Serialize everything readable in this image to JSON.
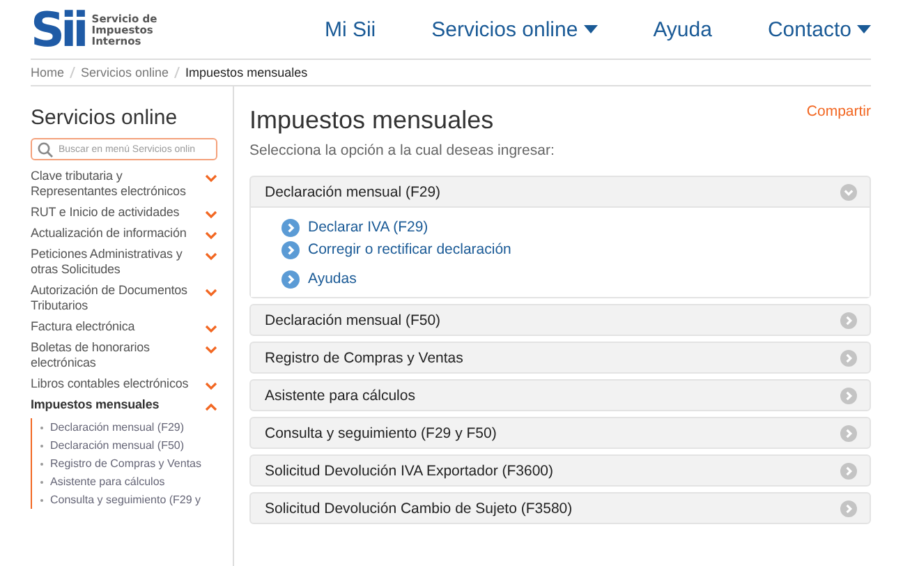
{
  "logo": {
    "mark": "Sii",
    "lines": [
      "Servicio de",
      "Impuestos",
      "Internos"
    ]
  },
  "nav": [
    {
      "label": "Mi Sii",
      "dropdown": false
    },
    {
      "label": "Servicios online",
      "dropdown": true
    },
    {
      "label": "Ayuda",
      "dropdown": false
    },
    {
      "label": "Contacto",
      "dropdown": true
    }
  ],
  "breadcrumb": [
    {
      "label": "Home",
      "current": false
    },
    {
      "label": "Servicios online",
      "current": false
    },
    {
      "label": "Impuestos mensuales",
      "current": true
    }
  ],
  "sidebar": {
    "title": "Servicios online",
    "search": {
      "placeholder": "Buscar en menú Servicios onlin"
    },
    "items": [
      {
        "label": "Clave tributaria y Representantes electrónicos",
        "expanded": false
      },
      {
        "label": "RUT e Inicio de actividades",
        "expanded": false
      },
      {
        "label": "Actualización de información",
        "expanded": false
      },
      {
        "label": "Peticiones Administrativas y otras Solicitudes",
        "expanded": false
      },
      {
        "label": "Autorización de Documentos Tributarios",
        "expanded": false
      },
      {
        "label": "Factura electrónica",
        "expanded": false
      },
      {
        "label": "Boletas de honorarios electrónicas",
        "expanded": false
      },
      {
        "label": "Libros contables electrónicos",
        "expanded": false
      },
      {
        "label": "Impuestos mensuales",
        "expanded": true,
        "children": [
          {
            "label": "Declaración mensual (F29)"
          },
          {
            "label": "Declaración mensual (F50)"
          },
          {
            "label": "Registro de Compras y Ventas"
          },
          {
            "label": "Asistente para cálculos"
          },
          {
            "label": "Consulta y seguimiento (F29 y"
          }
        ]
      }
    ]
  },
  "main": {
    "title": "Impuestos mensuales",
    "share": "Compartir",
    "subtitle": "Selecciona la opción a la cual deseas ingresar:",
    "panels": [
      {
        "title": "Declaración mensual (F29)",
        "expanded": true,
        "links": [
          "Declarar IVA (F29)",
          "Corregir o rectificar declaración",
          "Ayudas"
        ]
      },
      {
        "title": "Declaración mensual (F50)",
        "expanded": false
      },
      {
        "title": "Registro de Compras y Ventas",
        "expanded": false
      },
      {
        "title": "Asistente para cálculos",
        "expanded": false
      },
      {
        "title": "Consulta y seguimiento (F29 y F50)",
        "expanded": false
      },
      {
        "title": "Solicitud Devolución IVA Exportador (F3600)",
        "expanded": false
      },
      {
        "title": "Solicitud Devolución Cambio de Sujeto (F3580)",
        "expanded": false
      }
    ]
  }
}
